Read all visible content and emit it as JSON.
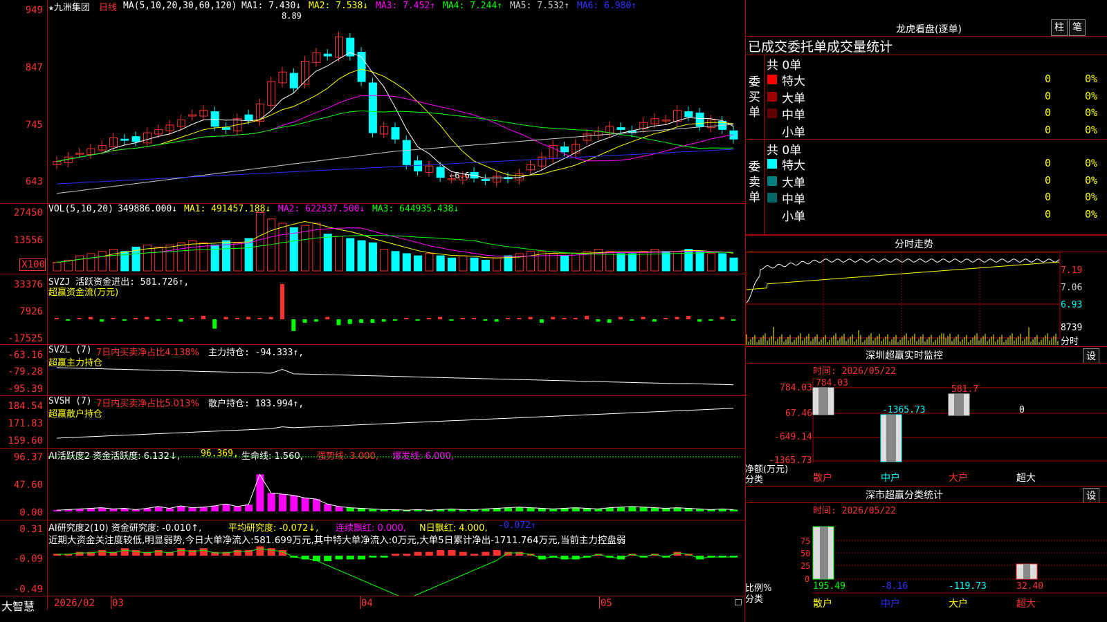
{
  "app": {
    "name": "大智慧",
    "lock_icon": "lock-icon"
  },
  "stock": {
    "name": "★九洲集团",
    "period": "日线"
  },
  "main_chart": {
    "title": "MA(5,10,20,30,60,120)",
    "ma1": "MA1: 7.430↓",
    "ma2": "MA2: 7.538↓",
    "ma3": "MA3: 7.452↑",
    "ma4": "MA4: 7.244↑",
    "ma5": "MA5: 7.532↑",
    "ma6": "MA6: 6.980↑",
    "y_ticks": [
      "949",
      "847",
      "745",
      "643"
    ],
    "high_mark": "8.89",
    "low_mark": "←6.60"
  },
  "vol_chart": {
    "title": "VOL(5,10,20)",
    "value": "349886.000↓",
    "ma1": "MA1: 491457.188↓",
    "ma2": "MA2: 622537.500↓",
    "ma3": "MA3: 644935.438↓",
    "y_ticks": [
      "27450",
      "13556",
      "X100"
    ]
  },
  "svzj": {
    "title": "SVZJ  活跃资金进出: 581.726↑,",
    "subtitle": "超赢资金流(万元)",
    "y_ticks": [
      "33376",
      "7926",
      "-17525"
    ]
  },
  "svzl": {
    "title": "SVZL (7)",
    "note": "7日内买卖净占比4.138%",
    "value": "主力持仓: -94.333↑,",
    "subtitle": "超赢主力持仓",
    "y_ticks": [
      "-63.16",
      "-79.28",
      "-95.39"
    ]
  },
  "svsh": {
    "title": "SVSH (7)",
    "note": "7日内买卖净占比5.013%",
    "value": "散户持仓: 183.994↑,",
    "subtitle": "超赢散户持仓",
    "y_ticks": [
      "184.54",
      "171.83",
      "159.60"
    ]
  },
  "ai_active": {
    "title": "AI活跃度2 资金活跃度: 6.132↓,",
    "v2": "96.369,",
    "v3": "生命线: 1.560,",
    "v4": "强势线: 3.000,",
    "v5": "爆发线: 6.000,",
    "y_ticks": [
      "96.37",
      "47.60",
      "0.00"
    ]
  },
  "ai_research": {
    "title": "AI研究度2(10) 资金研究度: -0.010↑,",
    "v2": "平均研究度: -0.072↓,",
    "v3": "连续飘红: 0.000,",
    "v4": "N日飘红: 4.000,",
    "v5": "-0.072↑",
    "comment": "近期大资金关注度较低,明显弱势,今日大单净流入:581.699万元,其中特大单净流入:0万元,大单5日累计净出-1711.764万元,当前主力控盘弱",
    "y_ticks": [
      "0.31",
      "-0.09",
      "-0.49"
    ]
  },
  "x_axis": [
    "2026/02",
    "03",
    "04",
    "05"
  ],
  "dragon": {
    "title": "龙虎看盘(逐单)",
    "btn1": "柱",
    "btn2": "笔",
    "header": "已成交委托单成交量统计",
    "buy_label": "委买单",
    "sell_label": "委卖单",
    "buy_total": "共 0单",
    "sell_total": "共 0单",
    "rows_buy": [
      {
        "name": "特大",
        "count": "0",
        "pct": "0%",
        "color": "#ff0000"
      },
      {
        "name": "大单",
        "count": "0",
        "pct": "0%",
        "color": "#a00000"
      },
      {
        "name": "中单",
        "count": "0",
        "pct": "0%",
        "color": "#600000"
      },
      {
        "name": "小单",
        "count": "0",
        "pct": "0%",
        "color": "#000000"
      }
    ],
    "rows_sell": [
      {
        "name": "特大",
        "count": "0",
        "pct": "0%",
        "color": "#00ffff"
      },
      {
        "name": "大单",
        "count": "0",
        "pct": "0%",
        "color": "#008080"
      },
      {
        "name": "中单",
        "count": "0",
        "pct": "0%",
        "color": "#006666"
      },
      {
        "name": "小单",
        "count": "0",
        "pct": "0%",
        "color": "#000000"
      }
    ]
  },
  "intraday": {
    "title": "分时走势",
    "y_ticks": [
      "7.19",
      "7.06",
      "6.93"
    ],
    "vol_label": "8739",
    "vol_unit": "分时"
  },
  "monitor": {
    "title": "深圳超赢实时监控",
    "set": "设",
    "time": "时间: 2026/05/22",
    "y_ticks": [
      "784.03",
      "67.46",
      "-649.14",
      "-1365.73"
    ],
    "ylabel": "净额(万元)",
    "xlabel": "分类",
    "values": [
      "784.03",
      "-1365.73",
      "581.7",
      "0"
    ],
    "cats": [
      "散户",
      "中户",
      "大户",
      "超大"
    ]
  },
  "classify": {
    "title": "深市超赢分类统计",
    "set": "设",
    "time": "时间: 2026/05/22",
    "y_ticks": [
      "75",
      "50",
      "25",
      "0"
    ],
    "ylabel": "比例%",
    "xlabel": "分类",
    "values": [
      "195.49",
      "-8.16",
      "-119.73",
      "32.40"
    ],
    "cats": [
      "散户",
      "中户",
      "大户",
      "超大"
    ]
  },
  "colors": {
    "up": "#ff3232",
    "down": "#00ffff",
    "border": "#aa0000",
    "yellow": "#ffff00",
    "magenta": "#ff00ff",
    "green": "#00ff00"
  }
}
